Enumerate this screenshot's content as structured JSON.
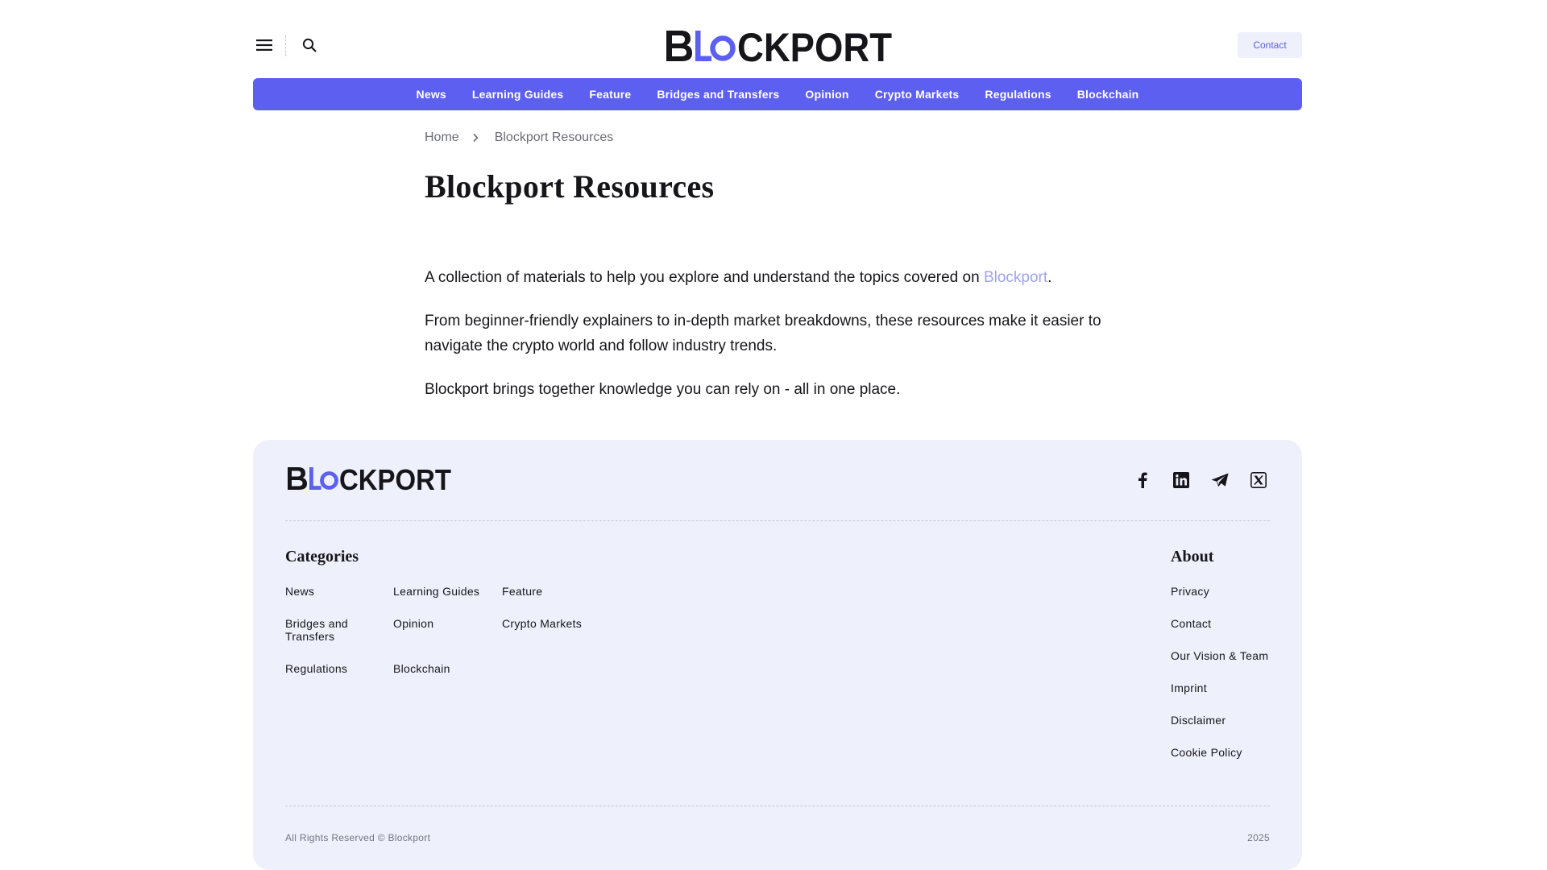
{
  "brand": {
    "name": "BLOCKPORT",
    "accent": "#5c5ff0",
    "accent_light": "#9ea3f3"
  },
  "header": {
    "menu_icon": "hamburger-menu-icon",
    "search_icon": "search-icon",
    "contact_label": "Contact"
  },
  "nav": {
    "items": [
      {
        "label": "News"
      },
      {
        "label": "Learning Guides"
      },
      {
        "label": "Feature"
      },
      {
        "label": "Bridges and Transfers"
      },
      {
        "label": "Opinion"
      },
      {
        "label": "Crypto Markets"
      },
      {
        "label": "Regulations"
      },
      {
        "label": "Blockchain"
      }
    ]
  },
  "breadcrumb": {
    "home": "Home",
    "current": "Blockport Resources"
  },
  "page": {
    "title": "Blockport Resources",
    "p1_before": "A collection of materials to help you explore and understand the topics covered on ",
    "p1_link": "Blockport",
    "p1_after": ".",
    "p2": "From beginner-friendly explainers to in-depth market breakdowns, these resources make it easier to navigate the crypto world and follow industry trends.",
    "p3": "Blockport brings together knowledge you can rely on - all in one place."
  },
  "footer": {
    "socials": [
      "facebook-icon",
      "linkedin-icon",
      "telegram-icon",
      "x-icon"
    ],
    "categories_heading": "Categories",
    "categories": [
      {
        "label": "News"
      },
      {
        "label": "Learning Guides"
      },
      {
        "label": "Feature"
      },
      {
        "label": "Bridges and Transfers"
      },
      {
        "label": "Opinion"
      },
      {
        "label": "Crypto Markets"
      },
      {
        "label": "Regulations"
      },
      {
        "label": "Blockchain"
      }
    ],
    "about_heading": "About",
    "about": [
      {
        "label": "Privacy"
      },
      {
        "label": "Contact"
      },
      {
        "label": "Our Vision & Team"
      },
      {
        "label": "Imprint"
      },
      {
        "label": "Disclaimer"
      },
      {
        "label": "Cookie Policy"
      }
    ],
    "copyright": "All Rights Reserved © Blockport",
    "year": "2025"
  }
}
